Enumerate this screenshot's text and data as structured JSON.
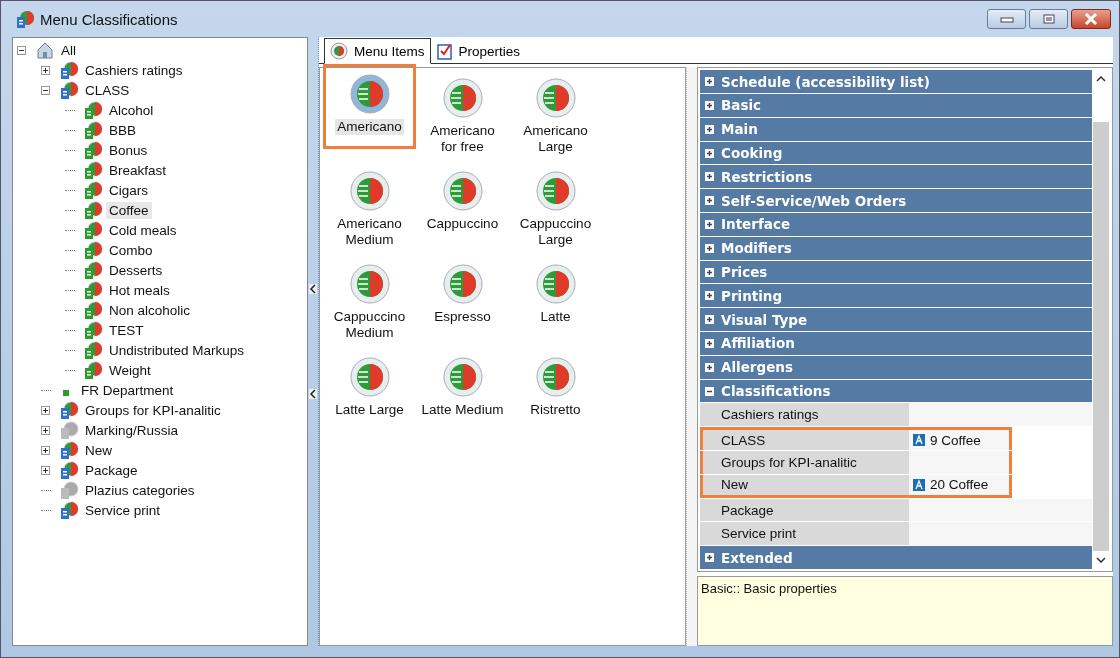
{
  "window": {
    "title": "Menu Classifications"
  },
  "tree": [
    {
      "label": "All",
      "kind": "home",
      "expanded": true,
      "selected": false,
      "children": [
        {
          "label": "Cashiers ratings",
          "kind": "folder",
          "expanded": false,
          "selected": false
        },
        {
          "label": "CLASS",
          "kind": "folder",
          "expanded": true,
          "selected": false,
          "children": [
            {
              "label": "Alcohol",
              "kind": "leaf",
              "selected": false
            },
            {
              "label": "BBB",
              "kind": "leaf",
              "selected": false
            },
            {
              "label": "Bonus",
              "kind": "leaf",
              "selected": false
            },
            {
              "label": "Breakfast",
              "kind": "leaf",
              "selected": false
            },
            {
              "label": "Cigars",
              "kind": "leaf",
              "selected": false
            },
            {
              "label": "Coffee",
              "kind": "leaf",
              "selected": true
            },
            {
              "label": "Cold meals",
              "kind": "leaf",
              "selected": false
            },
            {
              "label": "Combo",
              "kind": "leaf",
              "selected": false
            },
            {
              "label": "Desserts",
              "kind": "leaf",
              "selected": false
            },
            {
              "label": "Hot meals",
              "kind": "leaf",
              "selected": false
            },
            {
              "label": "Non alcoholic",
              "kind": "leaf",
              "selected": false
            },
            {
              "label": "TEST",
              "kind": "leaf",
              "selected": false
            },
            {
              "label": "Undistributed Markups",
              "kind": "leaf",
              "selected": false
            },
            {
              "label": "Weight",
              "kind": "leaf",
              "selected": false
            }
          ]
        },
        {
          "label": "FR Department",
          "kind": "department",
          "selected": false
        },
        {
          "label": "Groups for KPI-analitic",
          "kind": "folder",
          "expanded": false,
          "selected": false
        },
        {
          "label": "Marking/Russia",
          "kind": "grey",
          "expanded": false,
          "selected": false
        },
        {
          "label": "New",
          "kind": "folder",
          "expanded": false,
          "selected": false
        },
        {
          "label": "Package",
          "kind": "folder",
          "expanded": false,
          "selected": false
        },
        {
          "label": "Plazius categories",
          "kind": "grey",
          "selected": false
        },
        {
          "label": "Service print",
          "kind": "folder",
          "selected": false
        }
      ]
    }
  ],
  "tabs": [
    {
      "label": "Menu Items",
      "kind": "dish",
      "selected": true
    },
    {
      "label": "Properties",
      "kind": "checklist",
      "selected": false
    }
  ],
  "menu_items": [
    {
      "label": "Americano",
      "selected": true,
      "highlighted": true
    },
    {
      "label": "Americano for free",
      "selected": false,
      "highlighted": false
    },
    {
      "label": "Americano Large",
      "selected": false,
      "highlighted": false
    },
    {
      "label": "Americano Medium",
      "selected": false,
      "highlighted": false
    },
    {
      "label": "Cappuccino",
      "selected": false,
      "highlighted": false
    },
    {
      "label": "Cappuccino Large",
      "selected": false,
      "highlighted": false
    },
    {
      "label": "Cappuccino Medium",
      "selected": false,
      "highlighted": false
    },
    {
      "label": "Espresso",
      "selected": false,
      "highlighted": false
    },
    {
      "label": "Latte",
      "selected": false,
      "highlighted": false
    },
    {
      "label": "Latte Large",
      "selected": false,
      "highlighted": false
    },
    {
      "label": "Latte Medium",
      "selected": false,
      "highlighted": false
    },
    {
      "label": "Ristretto",
      "selected": false,
      "highlighted": false
    }
  ],
  "properties": [
    {
      "label": "Schedule (accessibility list)",
      "expanded": false
    },
    {
      "label": "Basic",
      "expanded": false
    },
    {
      "label": "Main",
      "expanded": false
    },
    {
      "label": "Cooking",
      "expanded": false
    },
    {
      "label": "Restrictions",
      "expanded": false
    },
    {
      "label": "Self-Service/Web Orders",
      "expanded": false
    },
    {
      "label": "Interface",
      "expanded": false
    },
    {
      "label": "Modifiers",
      "expanded": false
    },
    {
      "label": "Prices",
      "expanded": false
    },
    {
      "label": "Printing",
      "expanded": false
    },
    {
      "label": "Visual Type",
      "expanded": false
    },
    {
      "label": "Affiliation",
      "expanded": false
    },
    {
      "label": "Allergens",
      "expanded": false
    },
    {
      "label": "Classifications",
      "expanded": true,
      "rows": [
        {
          "name": "Cashiers ratings",
          "highlighted": false
        },
        {
          "name": "CLASS",
          "value": "9 Coffee",
          "highlighted": true
        },
        {
          "name": "Groups for KPI-analitic",
          "highlighted": true
        },
        {
          "name": "New",
          "value": "20 Coffee",
          "highlighted": true
        },
        {
          "name": "Package",
          "highlighted": false
        },
        {
          "name": "Service print",
          "highlighted": false
        }
      ]
    },
    {
      "label": "Extended",
      "expanded": false
    }
  ],
  "description": "Basic:: Basic properties"
}
